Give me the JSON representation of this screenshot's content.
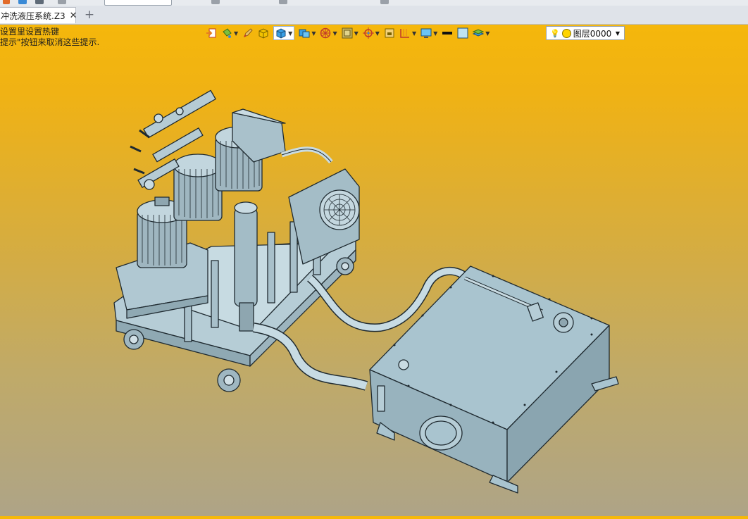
{
  "document_tab": {
    "title": "冲洗液压系统.Z3",
    "close": "✕"
  },
  "new_tab": "+",
  "hints": {
    "line1": "设置里设置热键",
    "line2": "提示\"按钮来取消这些提示."
  },
  "layer": {
    "name": "图层0000"
  },
  "toolbar_icons": [
    "import-icon",
    "paint-bucket-icon",
    "pencil-icon",
    "box-icon",
    "display-mode-icon",
    "render-icon",
    "wheel-icon",
    "texture-icon",
    "target-icon",
    "frame-icon",
    "dimension-icon",
    "monitor-icon",
    "line-color-icon",
    "fill-color-icon",
    "layer-stack-icon"
  ],
  "colors": {
    "background_top": "#f7b908",
    "background_bottom": "#aea487",
    "model_face": "#a9c4cf",
    "model_edge": "#1f2a30"
  }
}
